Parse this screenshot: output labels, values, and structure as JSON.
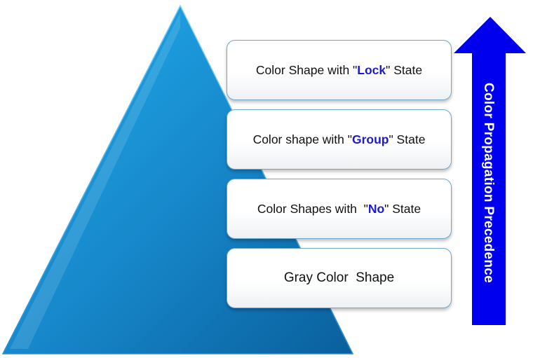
{
  "diagram": {
    "levels": [
      {
        "before": "Color Shape with \"",
        "highlight": "Lock",
        "after": "\" State"
      },
      {
        "before": "Color shape with \"",
        "highlight": "Group",
        "after": "\" State"
      },
      {
        "before": "Color Shapes with  \"",
        "highlight": "No",
        "after": "\" State"
      },
      {
        "text": "Gray Color  Shape"
      }
    ],
    "arrow_label": "Color Propagation Precedence"
  },
  "colors": {
    "pyramid_light": "#1aa3e6",
    "pyramid_dark": "#0a5f9c",
    "arrow": "#0000ee",
    "highlight": "#1a1ad6",
    "box_border": "#6fa8c8"
  }
}
